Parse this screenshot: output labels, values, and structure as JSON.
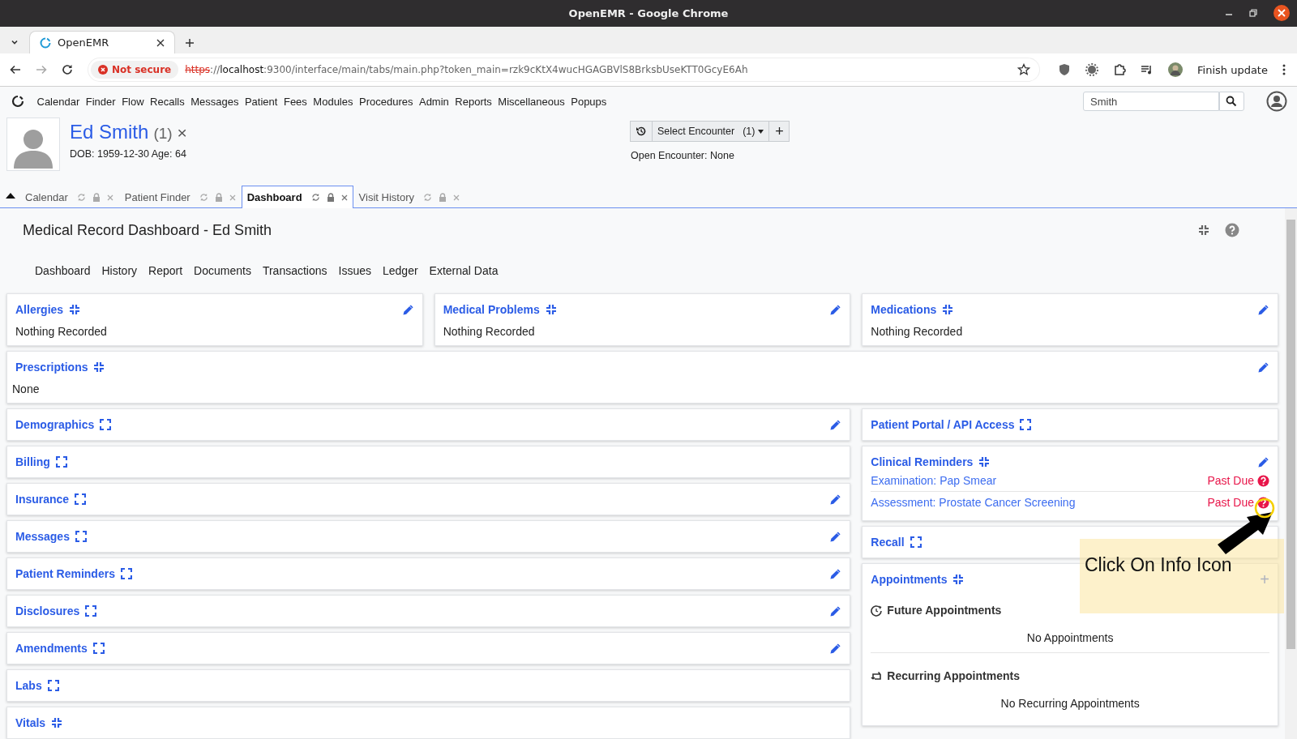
{
  "window": {
    "title": "OpenEMR - Google Chrome"
  },
  "browser": {
    "tab": {
      "title": "OpenEMR"
    },
    "security": "Not secure",
    "url": {
      "scheme": "https",
      "sep": "://",
      "host": "localhost",
      "rest": ":9300/interface/main/tabs/main.php?token_main=rzk9cKtX4wucHGAGBVlS8BrksbUseKTT0GcyE6Ah"
    },
    "update_button": "Finish update"
  },
  "menu": [
    "Calendar",
    "Finder",
    "Flow",
    "Recalls",
    "Messages",
    "Patient",
    "Fees",
    "Modules",
    "Procedures",
    "Admin",
    "Reports",
    "Miscellaneous",
    "Popups"
  ],
  "search": {
    "value": "Smith"
  },
  "patient": {
    "name": "Ed Smith",
    "count": "(1)",
    "close": "×",
    "dob": "DOB: 1959-12-30 Age: 64"
  },
  "encounter": {
    "select": "Select Encounter",
    "count": "(1)",
    "add": "+",
    "open": "Open Encounter: None"
  },
  "tabs": [
    {
      "label": "Calendar",
      "selected": false
    },
    {
      "label": "Patient Finder",
      "selected": false
    },
    {
      "label": "Dashboard",
      "selected": true
    },
    {
      "label": "Visit History",
      "selected": false
    }
  ],
  "page": {
    "title": "Medical Record Dashboard - Ed Smith",
    "subnav": [
      "Dashboard",
      "History",
      "Report",
      "Documents",
      "Transactions",
      "Issues",
      "Ledger",
      "External Data"
    ]
  },
  "top_cards": [
    {
      "kind": "text",
      "title": "Allergies",
      "expanded": true,
      "editable": true,
      "body": "Nothing Recorded"
    },
    {
      "kind": "text",
      "title": "Medical Problems",
      "expanded": true,
      "editable": true,
      "body": "Nothing Recorded"
    },
    {
      "kind": "text",
      "title": "Medications",
      "expanded": true,
      "editable": true,
      "body": "Nothing Recorded"
    }
  ],
  "prescriptions": {
    "kind": "text",
    "title": "Prescriptions",
    "expanded": true,
    "editable": true,
    "body": "None"
  },
  "left_cards": [
    {
      "title": "Demographics",
      "expanded": false,
      "editable": true
    },
    {
      "title": "Billing",
      "expanded": false,
      "editable": false
    },
    {
      "title": "Insurance",
      "expanded": false,
      "editable": true
    },
    {
      "title": "Messages",
      "expanded": false,
      "editable": true
    },
    {
      "title": "Patient Reminders",
      "expanded": false,
      "editable": true
    },
    {
      "title": "Disclosures",
      "expanded": false,
      "editable": true
    },
    {
      "title": "Amendments",
      "expanded": false,
      "editable": true
    },
    {
      "title": "Labs",
      "expanded": false,
      "editable": false
    },
    {
      "title": "Vitals",
      "expanded": true,
      "editable": false
    }
  ],
  "right_cards": [
    {
      "title": "Patient Portal / API Access",
      "expanded": false,
      "editable": false
    },
    {
      "kind": "reminders",
      "title": "Clinical Reminders",
      "expanded": true,
      "editable": true,
      "items": [
        {
          "label": "Examination: Pap Smear",
          "status": "Past Due"
        },
        {
          "label": "Assessment: Prostate Cancer Screening",
          "status": "Past Due"
        }
      ]
    },
    {
      "title": "Recall",
      "expanded": false,
      "editable": false
    },
    {
      "kind": "appointments",
      "title": "Appointments",
      "expanded": true,
      "editable": false,
      "add": "+",
      "sections": [
        {
          "kind": "future",
          "title": "Future Appointments",
          "empty": "No Appointments"
        },
        {
          "kind": "recurring",
          "title": "Recurring Appointments",
          "empty": "No Recurring Appointments"
        }
      ]
    }
  ],
  "annotation": {
    "text": "Click On Info Icon"
  }
}
